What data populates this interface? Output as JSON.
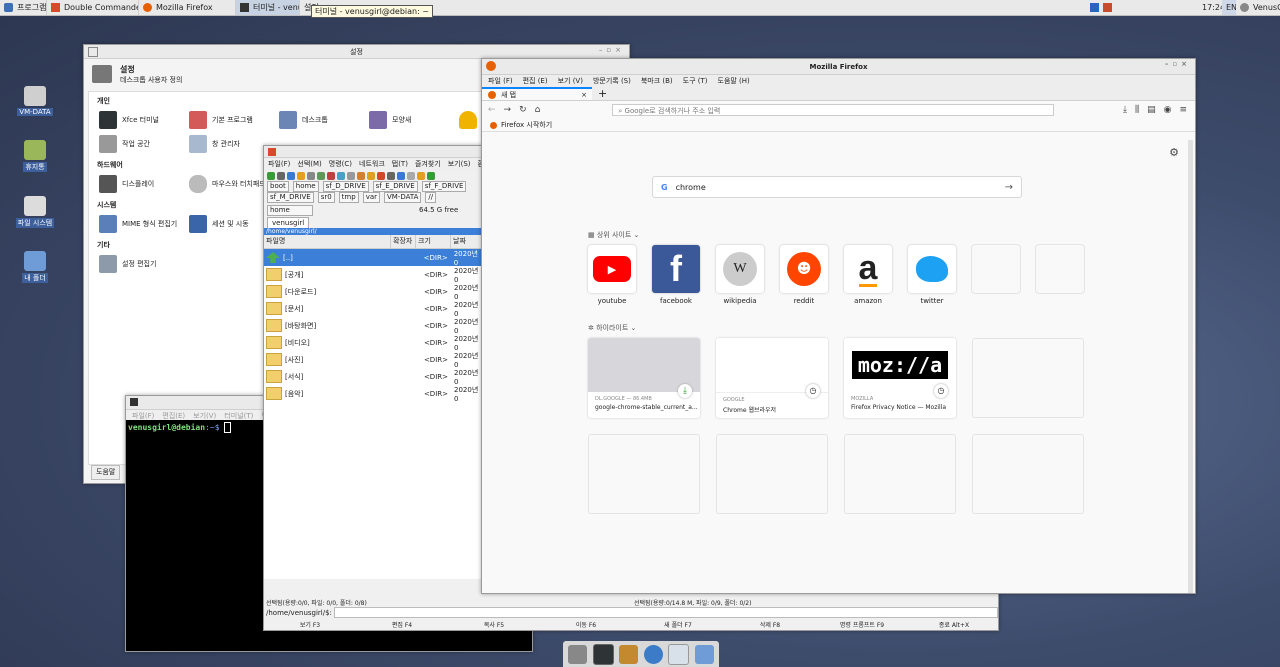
{
  "colors": {
    "accent": "#3c7fd8",
    "ff_blue": "#0a84ff",
    "taskbar": "#e9e9e9"
  },
  "top_panel": {
    "apps_menu": "프로그램",
    "tasks": [
      "Double Commander",
      "Mozilla Firefox",
      "터미널 - venusgirl@debian: ~",
      "설정"
    ],
    "tooltip": "터미널 - venusgirl@debian: ~",
    "lang": "EN",
    "clock": "17:24",
    "user": "VenusGirl"
  },
  "desktop_icons": [
    "VM-DATA",
    "휴지통",
    "파일 시스템",
    "내 폴더"
  ],
  "settings": {
    "title": "설정",
    "heading": "설정",
    "subheading": "데스크톱 사용자 정의",
    "sections": [
      {
        "name": "개인",
        "rows": [
          [
            "Xfce 터미널",
            "기본 프로그램",
            "데스크톱",
            "모양새"
          ],
          [
            "작업 공간",
            "창 관리자"
          ]
        ]
      },
      {
        "name": "하드웨어",
        "rows": [
          [
            "디스플레이",
            "마우스와 터치패드"
          ]
        ]
      },
      {
        "name": "시스템",
        "rows": [
          [
            "MIME 형식 편집기",
            "세션 및 시동"
          ]
        ]
      },
      {
        "name": "기타",
        "rows": [
          [
            "설정 편집기"
          ]
        ]
      }
    ],
    "help_button": "도움말"
  },
  "double_commander": {
    "menu": [
      "파일(F)",
      "선택(M)",
      "명령(C)",
      "네트워크",
      "탭(T)",
      "즐겨찾기",
      "보기(S)",
      "환경"
    ],
    "drives_row1": [
      "boot",
      "home",
      "sf_D_DRIVE",
      "sf_E_DRIVE",
      "sf_F_DRIVE"
    ],
    "drives_row2": [
      "sf_M_DRIVE",
      "sr0",
      "tmp",
      "var",
      "VM-DATA",
      "//"
    ],
    "current_drive": "home",
    "free_space": "64.5 G free",
    "tab": "venusgirl",
    "path": "/home/venusgirl/",
    "columns": [
      "파일명",
      "확장자",
      "크기",
      "날짜"
    ],
    "rows": [
      {
        "name": "[..]",
        "size": "<DIR>",
        "date": "2020년 0"
      },
      {
        "name": "[공개]",
        "size": "<DIR>",
        "date": "2020년 0"
      },
      {
        "name": "[다운로드]",
        "size": "<DIR>",
        "date": "2020년 0"
      },
      {
        "name": "[문서]",
        "size": "<DIR>",
        "date": "2020년 0"
      },
      {
        "name": "[바탕화면]",
        "size": "<DIR>",
        "date": "2020년 0"
      },
      {
        "name": "[비디오]",
        "size": "<DIR>",
        "date": "2020년 0"
      },
      {
        "name": "[사진]",
        "size": "<DIR>",
        "date": "2020년 0"
      },
      {
        "name": "[서식]",
        "size": "<DIR>",
        "date": "2020년 0"
      },
      {
        "name": "[음악]",
        "size": "<DIR>",
        "date": "2020년 0"
      }
    ],
    "status_left": "선택됨(용량:0/0, 파일: 0/0, 폴더: 0/8)",
    "status_right": "선택됨(용량:0/14.8 M, 파일: 0/9, 폴더: 0/2)",
    "cmdline": "/home/venusgirl/$:",
    "fkeys": [
      "보기 F3",
      "편집 F4",
      "복사 F5",
      "이동 F6",
      "새 폴더 F7",
      "삭제 F8",
      "명령 프롬프트 F9",
      "종료 Alt+X"
    ]
  },
  "terminal": {
    "menu": [
      "파일(F)",
      "편집(E)",
      "보기(V)",
      "터미널(T)",
      "탭"
    ],
    "prompt_user": "venusgirl@debian",
    "prompt_rest": ":~$"
  },
  "firefox": {
    "title": "Mozilla Firefox",
    "menu": [
      "파일 (F)",
      "편집 (E)",
      "보기 (V)",
      "방문기록 (S)",
      "북마크 (B)",
      "도구 (T)",
      "도움말 (H)"
    ],
    "tab": "새 탭",
    "url_placeholder": "Google로 검색하거나 주소 입력",
    "bookmark": "Firefox 시작하기",
    "search_text": "chrome",
    "top_sites_label": "상위 사이트",
    "top_sites": [
      "youtube",
      "facebook",
      "wikipedia",
      "reddit",
      "amazon",
      "twitter"
    ],
    "highlights_label": "하이라이트",
    "highlights": [
      {
        "source": "DL.GOOGLE — 86.4MB",
        "title": "google-chrome-stable_current_a..."
      },
      {
        "source": "GOOGLE",
        "title": "Chrome 웹브라우저"
      },
      {
        "source": "MOZILLA",
        "title": "Firefox Privacy Notice — Mozilla",
        "logo": "moz://a"
      }
    ]
  }
}
